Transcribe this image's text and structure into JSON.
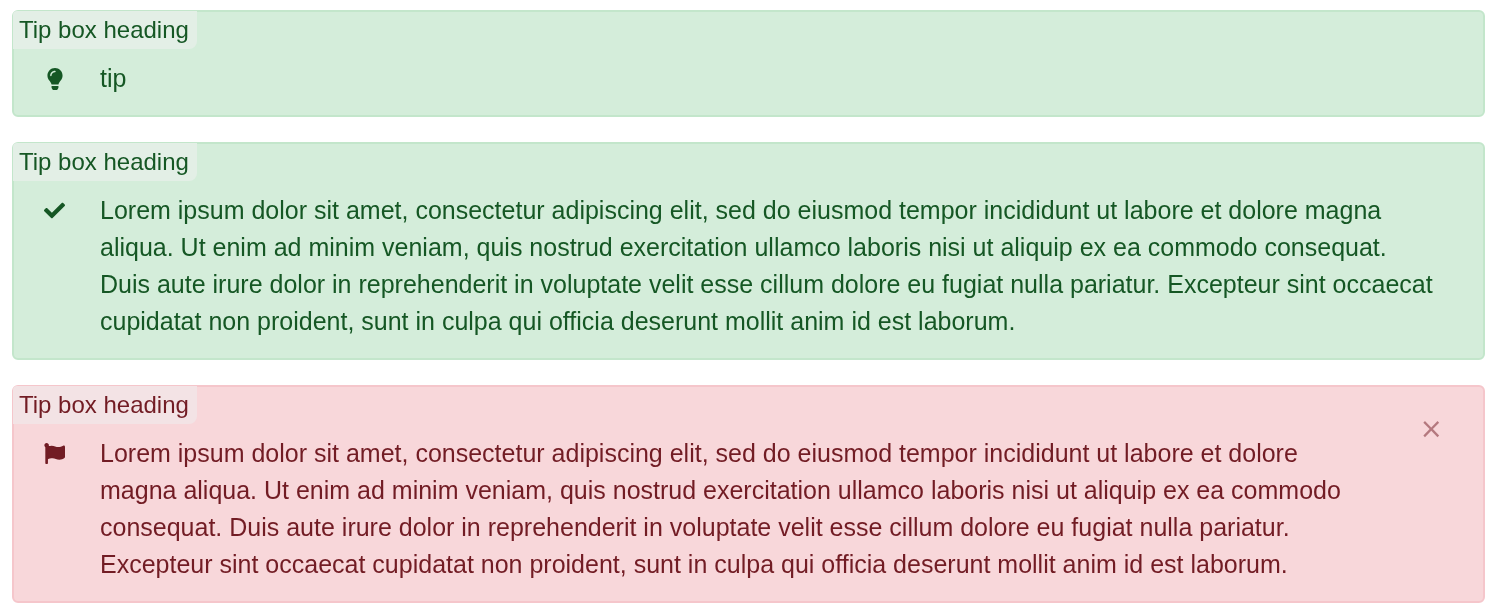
{
  "tip_boxes": [
    {
      "kind": "tip",
      "heading": "Tip box heading",
      "text": "tip"
    },
    {
      "kind": "success",
      "heading": "Tip box heading",
      "text": "Lorem ipsum dolor sit amet, consectetur adipiscing elit, sed do eiusmod tempor incididunt ut labore et dolore magna aliqua. Ut enim ad minim veniam, quis nostrud exercitation ullamco laboris nisi ut aliquip ex ea commodo consequat. Duis aute irure dolor in reprehenderit in voluptate velit esse cillum dolore eu fugiat nulla pariatur. Excepteur sint occaecat cupidatat non proident, sunt in culpa qui officia deserunt mollit anim id est laborum."
    },
    {
      "kind": "danger",
      "heading": "Tip box heading",
      "text": "Lorem ipsum dolor sit amet, consectetur adipiscing elit, sed do eiusmod tempor incididunt ut labore et dolore magna aliqua. Ut enim ad minim veniam, quis nostrud exercitation ullamco laboris nisi ut aliquip ex ea commodo consequat. Duis aute irure dolor in reprehenderit in voluptate velit esse cillum dolore eu fugiat nulla pariatur. Excepteur sint occaecat cupidatat non proident, sunt in culpa qui officia deserunt mollit anim id est laborum.",
      "close": "×"
    }
  ]
}
